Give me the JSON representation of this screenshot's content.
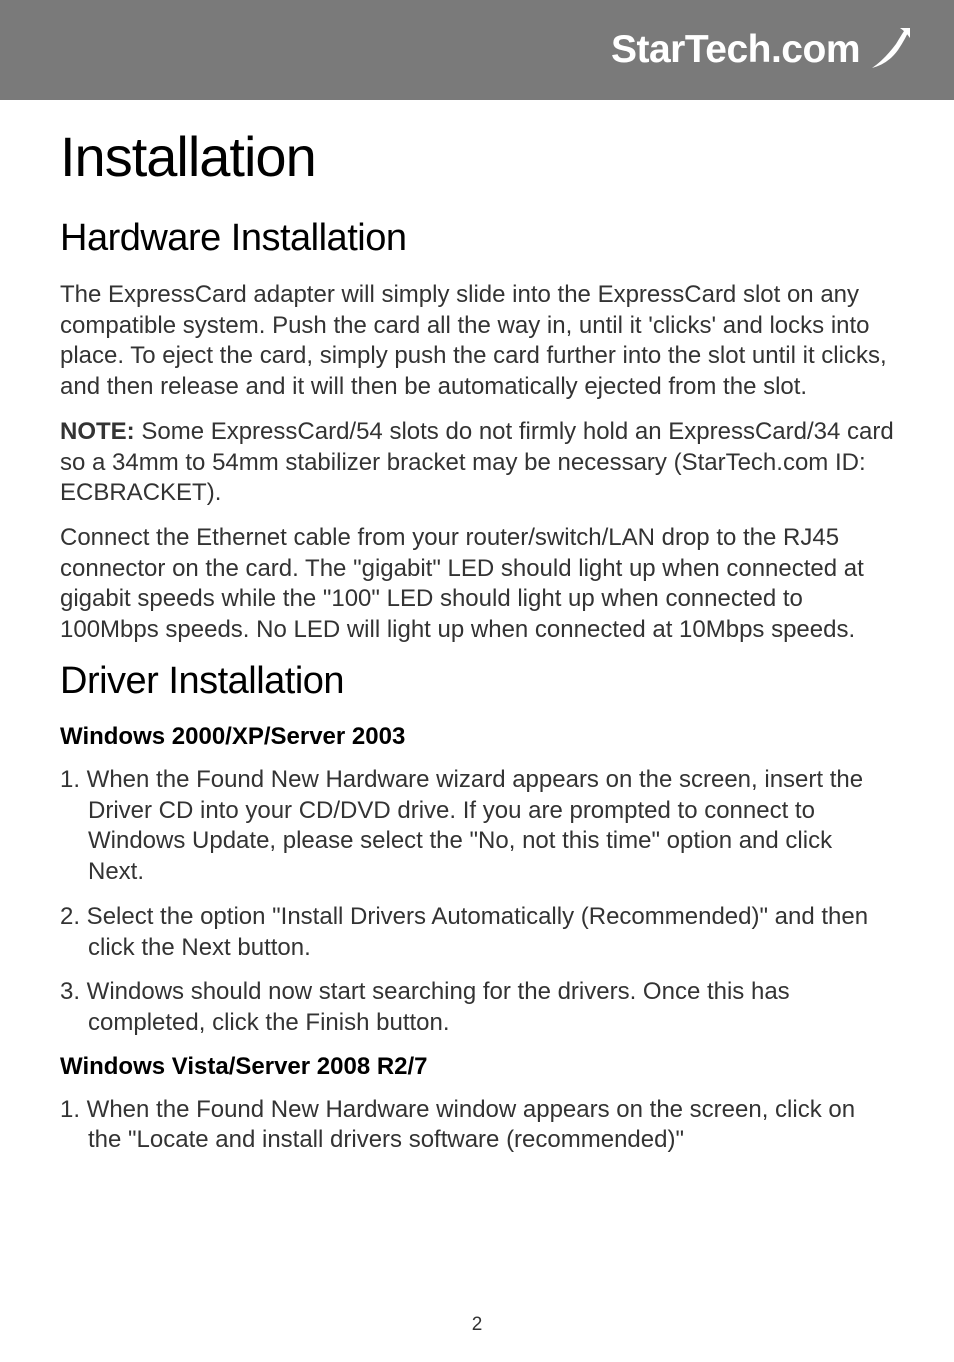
{
  "header": {
    "logo_text": "StarTech.com"
  },
  "content": {
    "title": "Installation",
    "section1": {
      "heading": "Hardware Installation",
      "para1": "The ExpressCard adapter will simply slide into the ExpressCard slot on any compatible system. Push the card all the way in, until it 'clicks' and locks into place. To eject the card, simply push the card further into the slot until it clicks, and then release and it will then be automatically ejected from the slot.",
      "note_label": "NOTE:",
      "note_body": " Some ExpressCard/54 slots do not firmly hold an ExpressCard/34 card so a 34mm to 54mm stabilizer bracket may be necessary (StarTech.com ID: ECBRACKET).",
      "para2": "Connect the Ethernet cable from your router/switch/LAN drop to the RJ45 connector on the card.  The \"gigabit\" LED should light up when connected at gigabit speeds while the \"100\" LED should light up when connected to 100Mbps speeds.  No LED will light up when connected at 10Mbps speeds."
    },
    "section2": {
      "heading": "Driver Installation",
      "sub1_heading": "Windows 2000/XP/Server 2003",
      "sub1_items": [
        "1. When the Found New Hardware wizard appears on the screen, insert the Driver CD into your CD/DVD drive. If you are prompted to connect to Windows Update, please select the \"No, not this time\" option and click Next.",
        "2. Select the option \"Install Drivers Automatically (Recommended)\" and then click the Next button.",
        "3. Windows should now start searching for the drivers. Once this has completed, click the Finish button."
      ],
      "sub2_heading": "Windows Vista/Server 2008 R2/7",
      "sub2_items": [
        "1. When the Found New Hardware window appears on the screen, click on the \"Locate and install drivers software (recommended)\""
      ]
    }
  },
  "page_number": "2"
}
